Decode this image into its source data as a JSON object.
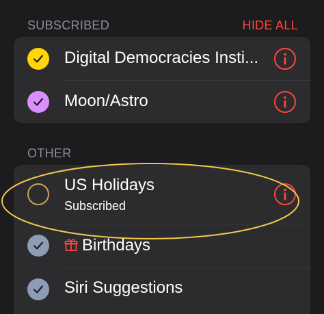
{
  "subscribed_section": {
    "title": "SUBSCRIBED",
    "hide_all_label": "HIDE ALL",
    "items": [
      {
        "label": "Digital Democracies Insti...",
        "check_color": "#ffd60a",
        "checked": true
      },
      {
        "label": "Moon/Astro",
        "check_color": "#da8fff",
        "checked": true
      }
    ]
  },
  "other_section": {
    "title": "OTHER",
    "items": [
      {
        "label": "US Holidays",
        "subtitle": "Subscribed",
        "check_color": "#c9a35e",
        "checked": false
      },
      {
        "label": "Birthdays",
        "check_color": "#8e9bb5",
        "checked": true,
        "icon": "gift-icon"
      },
      {
        "label": "Siri Suggestions",
        "check_color": "#8e9bb5",
        "checked": true
      }
    ]
  },
  "colors": {
    "accent_red": "#ff453a",
    "annotation_ellipse": "#f2c84b"
  }
}
